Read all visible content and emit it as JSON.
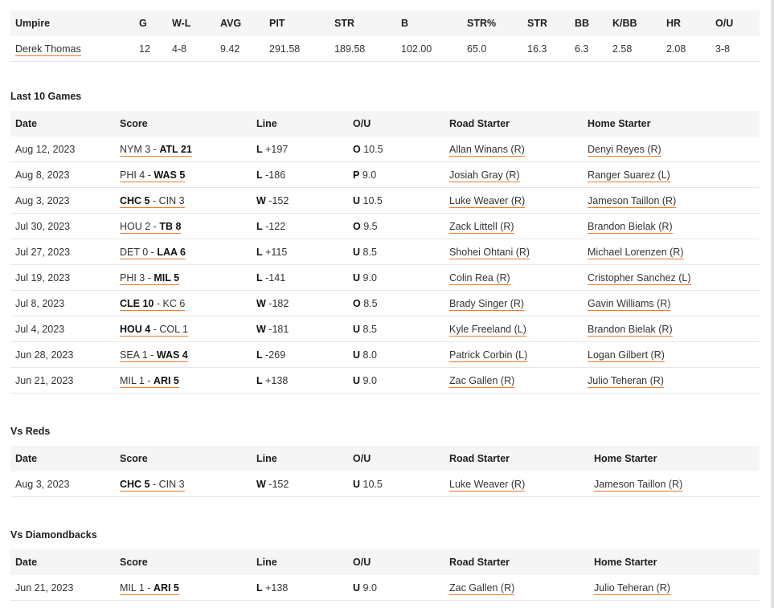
{
  "umpire_table": {
    "headers": [
      "Umpire",
      "G",
      "W-L",
      "AVG",
      "PIT",
      "STR",
      "B",
      "STR%",
      "STR",
      "BB",
      "K/BB",
      "HR",
      "O/U"
    ],
    "row": [
      "Derek Thomas",
      "12",
      "4-8",
      "9.42",
      "291.58",
      "189.58",
      "102.00",
      "65.0",
      "16.3",
      "6.3",
      "2.58",
      "2.08",
      "3-8"
    ]
  },
  "game_headers": {
    "date": "Date",
    "score": "Score",
    "line": "Line",
    "ou": "O/U",
    "road": "Road Starter",
    "home": "Home Starter"
  },
  "last10": {
    "title": "Last 10 Games",
    "rows": [
      {
        "date": "Aug 12, 2023",
        "away": "NYM 3",
        "home": "ATL 21",
        "winner": "home",
        "result": "L",
        "odds": "+197",
        "ou_code": "O",
        "ou_value": "10.5",
        "road": "Allan Winans (R)",
        "home_starter": "Denyi Reyes (R)"
      },
      {
        "date": "Aug 8, 2023",
        "away": "PHI 4",
        "home": "WAS 5",
        "winner": "home",
        "result": "L",
        "odds": "-186",
        "ou_code": "P",
        "ou_value": "9.0",
        "road": "Josiah Gray (R)",
        "home_starter": "Ranger Suarez (L)"
      },
      {
        "date": "Aug 3, 2023",
        "away": "CHC 5",
        "home": "CIN 3",
        "winner": "away",
        "result": "W",
        "odds": "-152",
        "ou_code": "U",
        "ou_value": "10.5",
        "road": "Luke Weaver (R)",
        "home_starter": "Jameson Taillon (R)"
      },
      {
        "date": "Jul 30, 2023",
        "away": "HOU 2",
        "home": "TB 8",
        "winner": "home",
        "result": "L",
        "odds": "-122",
        "ou_code": "O",
        "ou_value": "9.5",
        "road": "Zack Littell (R)",
        "home_starter": "Brandon Bielak (R)"
      },
      {
        "date": "Jul 27, 2023",
        "away": "DET 0",
        "home": "LAA 6",
        "winner": "home",
        "result": "L",
        "odds": "+115",
        "ou_code": "U",
        "ou_value": "8.5",
        "road": "Shohei Ohtani (R)",
        "home_starter": "Michael Lorenzen (R)"
      },
      {
        "date": "Jul 19, 2023",
        "away": "PHI 3",
        "home": "MIL 5",
        "winner": "home",
        "result": "L",
        "odds": "-141",
        "ou_code": "U",
        "ou_value": "9.0",
        "road": "Colin Rea (R)",
        "home_starter": "Cristopher Sanchez (L)"
      },
      {
        "date": "Jul 8, 2023",
        "away": "CLE 10",
        "home": "KC 6",
        "winner": "away",
        "result": "W",
        "odds": "-182",
        "ou_code": "O",
        "ou_value": "8.5",
        "road": "Brady Singer (R)",
        "home_starter": "Gavin Williams (R)"
      },
      {
        "date": "Jul 4, 2023",
        "away": "HOU 4",
        "home": "COL 1",
        "winner": "away",
        "result": "W",
        "odds": "-181",
        "ou_code": "U",
        "ou_value": "8.5",
        "road": "Kyle Freeland (L)",
        "home_starter": "Brandon Bielak (R)"
      },
      {
        "date": "Jun 28, 2023",
        "away": "SEA 1",
        "home": "WAS 4",
        "winner": "home",
        "result": "L",
        "odds": "-269",
        "ou_code": "U",
        "ou_value": "8.0",
        "road": "Patrick Corbin (L)",
        "home_starter": "Logan Gilbert (R)"
      },
      {
        "date": "Jun 21, 2023",
        "away": "MIL 1",
        "home": "ARI 5",
        "winner": "home",
        "result": "L",
        "odds": "+138",
        "ou_code": "U",
        "ou_value": "9.0",
        "road": "Zac Gallen (R)",
        "home_starter": "Julio Teheran (R)"
      }
    ]
  },
  "vs_reds": {
    "title": "Vs Reds",
    "rows": [
      {
        "date": "Aug 3, 2023",
        "away": "CHC 5",
        "home": "CIN 3",
        "winner": "away",
        "result": "W",
        "odds": "-152",
        "ou_code": "U",
        "ou_value": "10.5",
        "road": "Luke Weaver (R)",
        "home_starter": "Jameson Taillon (R)"
      }
    ]
  },
  "vs_dbacks": {
    "title": "Vs Diamondbacks",
    "rows": [
      {
        "date": "Jun 21, 2023",
        "away": "MIL 1",
        "home": "ARI 5",
        "winner": "home",
        "result": "L",
        "odds": "+138",
        "ou_code": "U",
        "ou_value": "9.0",
        "road": "Zac Gallen (R)",
        "home_starter": "Julio Teheran (R)"
      }
    ]
  },
  "colors": {
    "link_underline": "#f07a2a",
    "header_bg": "#f5f5f5",
    "row_border": "#e6e6e6"
  }
}
